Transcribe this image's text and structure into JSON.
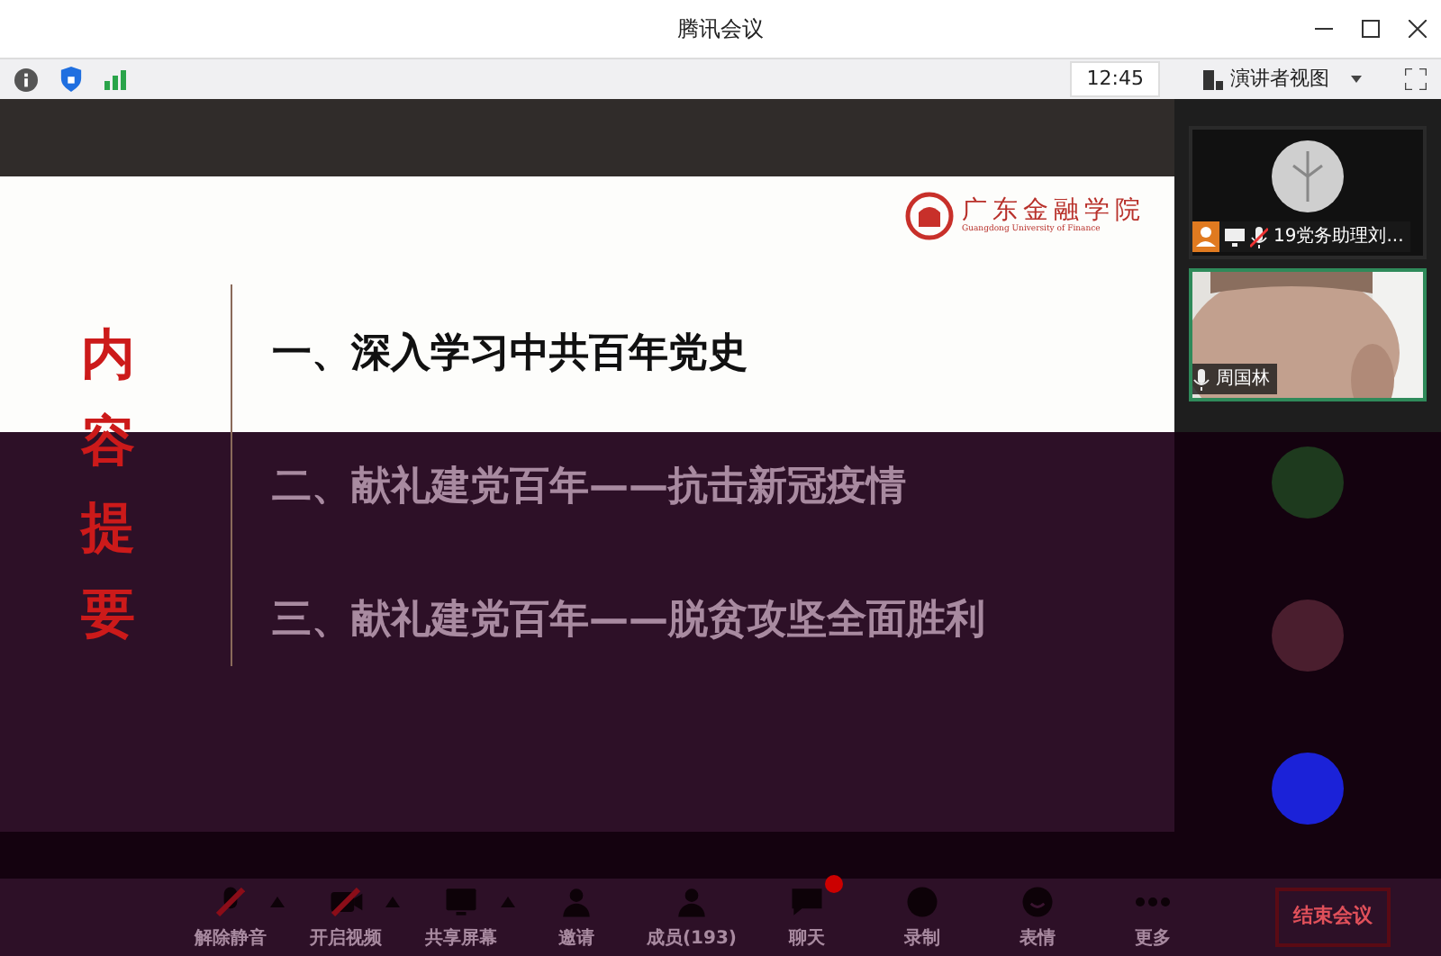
{
  "window": {
    "title": "腾讯会议"
  },
  "status_bar": {
    "time": "12:45",
    "view_button": "演讲者视图"
  },
  "slide": {
    "logo_name": "广东金融学院",
    "logo_subtitle": "Guangdong University of Finance",
    "side_title": "内容提要",
    "items": [
      "一、深入学习中共百年党史",
      "二、献礼建党百年——抗击新冠疫情",
      "三、献礼建党百年——脱贫攻坚全面胜利"
    ]
  },
  "participants": [
    {
      "kind": "tile",
      "name": "19党务助理刘...",
      "video": false,
      "muted": true
    },
    {
      "kind": "tile",
      "name": "周国林",
      "video": true,
      "muted": false
    },
    {
      "kind": "dot",
      "color": "#1e3a1e"
    },
    {
      "kind": "dot",
      "color": "#4a1e2e"
    },
    {
      "kind": "dot",
      "color": "#1b22d8"
    }
  ],
  "toolbar": [
    {
      "label": "解除静音",
      "kind": "mic",
      "menu": true,
      "off": true,
      "unread": false
    },
    {
      "label": "开启视频",
      "kind": "video",
      "menu": true,
      "off": true,
      "unread": false
    },
    {
      "label": "共享屏幕",
      "kind": "screen",
      "menu": true,
      "off": false,
      "unread": false
    },
    {
      "label": "邀请",
      "kind": "person",
      "menu": false,
      "off": false,
      "unread": false
    },
    {
      "label": "成员(193)",
      "kind": "person",
      "menu": false,
      "off": false,
      "unread": false
    },
    {
      "label": "聊天",
      "kind": "chat",
      "menu": false,
      "off": false,
      "unread": true
    },
    {
      "label": "录制",
      "kind": "record",
      "menu": false,
      "off": false,
      "unread": false
    },
    {
      "label": "表情",
      "kind": "smile",
      "menu": false,
      "off": false,
      "unread": false
    },
    {
      "label": "更多",
      "kind": "more",
      "menu": false,
      "off": false,
      "unread": false
    }
  ],
  "end_button": "结束会议"
}
